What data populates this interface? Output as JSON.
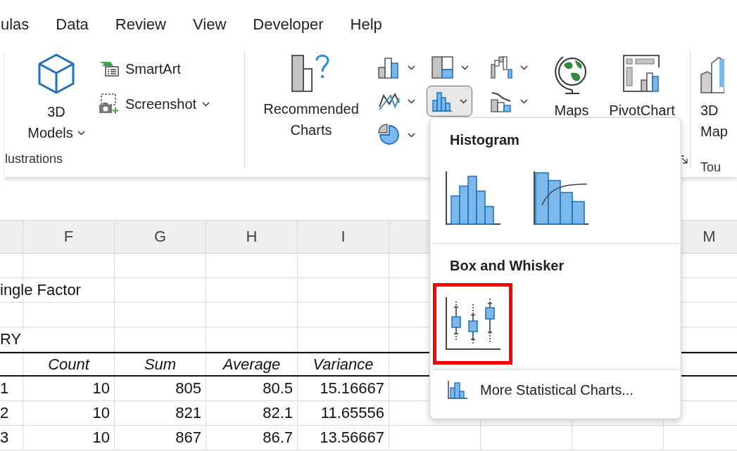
{
  "menu": [
    {
      "label": "ulas"
    },
    {
      "label": "Data"
    },
    {
      "label": "Review"
    },
    {
      "label": "View"
    },
    {
      "label": "Developer"
    },
    {
      "label": "Help"
    }
  ],
  "illustrations": {
    "models_label": [
      "3D",
      "Models"
    ],
    "smartart": "SmartArt",
    "screenshot": "Screenshot",
    "group_label": "lustrations"
  },
  "recommended": {
    "label": [
      "Recommended",
      "Charts"
    ]
  },
  "chart_buttons": [
    {
      "kind": "column",
      "selected": false
    },
    {
      "kind": "treemap",
      "selected": false
    },
    {
      "kind": "waterfall",
      "selected": false
    },
    {
      "kind": "line",
      "selected": false
    },
    {
      "kind": "histogram",
      "selected": true
    },
    {
      "kind": "combo",
      "selected": false
    },
    {
      "kind": "pie",
      "selected": false
    }
  ],
  "maps": {
    "label": "Maps"
  },
  "pivot": {
    "label": "PivotChart"
  },
  "tours": {
    "label": [
      "3D",
      "Map"
    ],
    "group_label": "Tou"
  },
  "popup": {
    "sections": [
      {
        "title": "Histogram",
        "items": [
          {
            "kind": "histogram",
            "highlighted": false
          },
          {
            "kind": "pareto",
            "highlighted": false
          }
        ]
      },
      {
        "title": "Box and Whisker",
        "items": [
          {
            "kind": "box_whisker",
            "highlighted": true
          }
        ]
      }
    ],
    "more": {
      "label": "More Statistical Charts..."
    }
  },
  "sheet": {
    "columns": [
      "F",
      "G",
      "H",
      "I"
    ],
    "far_column": "M",
    "rows": [
      {
        "kind": "blank"
      },
      {
        "kind": "text",
        "stub": "ingle Factor"
      },
      {
        "kind": "blank"
      },
      {
        "kind": "text",
        "stub": "RY"
      },
      {
        "kind": "header",
        "cells": [
          "Count",
          "Sum",
          "Average",
          "Variance"
        ]
      },
      {
        "kind": "data",
        "stub": "1",
        "cells": [
          "10",
          "805",
          "80.5",
          "15.16667"
        ]
      },
      {
        "kind": "data",
        "stub": "2",
        "cells": [
          "10",
          "821",
          "82.1",
          "11.65556"
        ]
      },
      {
        "kind": "data",
        "stub": "3",
        "cells": [
          "10",
          "867",
          "86.7",
          "13.56667"
        ]
      }
    ]
  }
}
